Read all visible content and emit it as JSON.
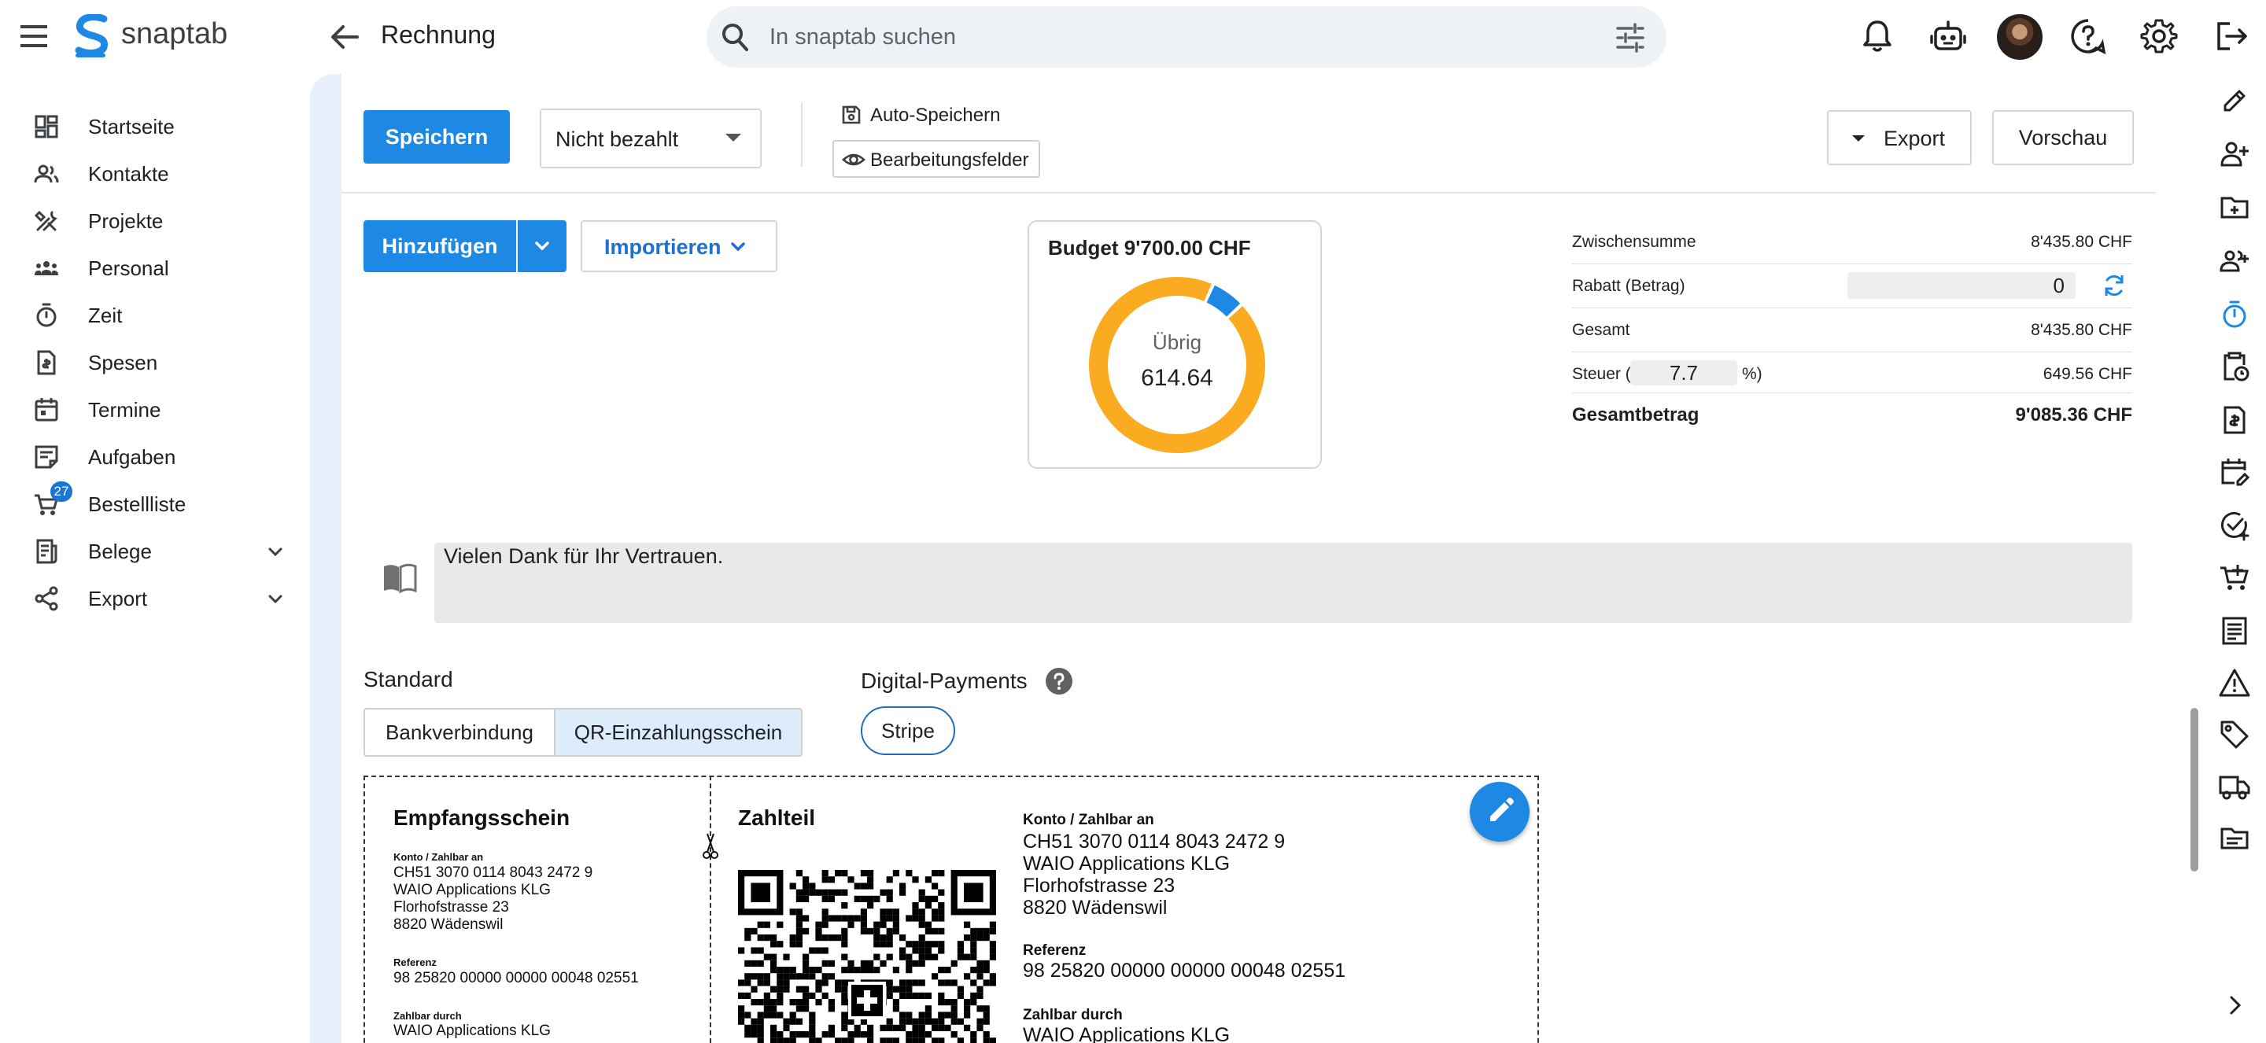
{
  "app": {
    "name": "snaptab",
    "page_title": "Rechnung"
  },
  "search": {
    "placeholder": "In snaptab suchen"
  },
  "sidebar": {
    "items": [
      {
        "label": "Startseite",
        "icon": "dashboard-icon"
      },
      {
        "label": "Kontakte",
        "icon": "contacts-icon"
      },
      {
        "label": "Projekte",
        "icon": "tools-icon"
      },
      {
        "label": "Personal",
        "icon": "people-icon"
      },
      {
        "label": "Zeit",
        "icon": "timer-icon"
      },
      {
        "label": "Spesen",
        "icon": "receipt-icon"
      },
      {
        "label": "Termine",
        "icon": "calendar-icon"
      },
      {
        "label": "Aufgaben",
        "icon": "task-icon"
      },
      {
        "label": "Bestellliste",
        "icon": "cart-icon",
        "badge": "27"
      },
      {
        "label": "Belege",
        "icon": "document-icon",
        "expandable": true
      },
      {
        "label": "Export",
        "icon": "share-icon",
        "expandable": true
      }
    ]
  },
  "toolbar": {
    "save_label": "Speichern",
    "status_value": "Nicht bezahlt",
    "autosave_label": "Auto-Speichern",
    "edit_fields_label": "Bearbeitungsfelder",
    "export_label": "Export",
    "preview_label": "Vorschau"
  },
  "actions": {
    "add_label": "Hinzufügen",
    "import_label": "Importieren"
  },
  "budget": {
    "title": "Budget 9'700.00 CHF",
    "remaining_label": "Übrig",
    "remaining_value": "614.64",
    "used_fraction": 0.937,
    "remaining_fraction": 0.063,
    "colors": {
      "used": "#fbab1f",
      "remaining": "#1e88e5"
    }
  },
  "totals": {
    "subtotal_label": "Zwischensumme",
    "subtotal_value": "8'435.80 CHF",
    "discount_label": "Rabatt (Betrag)",
    "discount_value": "0",
    "total_label": "Gesamt",
    "total_value": "8'435.80 CHF",
    "tax_label_prefix": "Steuer (",
    "tax_rate": "7.7",
    "tax_label_suffix": "%)",
    "tax_value": "649.56 CHF",
    "grand_total_label": "Gesamtbetrag",
    "grand_total_value": "9'085.36 CHF"
  },
  "note": {
    "text": "Vielen Dank für Ihr Vertrauen."
  },
  "payment": {
    "standard_label": "Standard",
    "options": [
      "Bankverbindung",
      "QR-Einzahlungsschein"
    ],
    "selected_option": "QR-Einzahlungsschein",
    "digital_label": "Digital-Payments",
    "stripe_label": "Stripe"
  },
  "qr_bill": {
    "receipt_title": "Empfangsschein",
    "payment_title": "Zahlteil",
    "account_heading": "Konto / Zahlbar an",
    "iban": "CH51 3070 0114 8043 2472 9",
    "creditor_name": "WAIO Applications KLG",
    "creditor_street": "Florhofstrasse 23",
    "creditor_city": "8820 Wädenswil",
    "reference_heading": "Referenz",
    "reference": "98 25820 00000 00000 00048 02551",
    "payable_by_heading": "Zahlbar durch",
    "payable_by": "WAIO Applications KLG"
  }
}
